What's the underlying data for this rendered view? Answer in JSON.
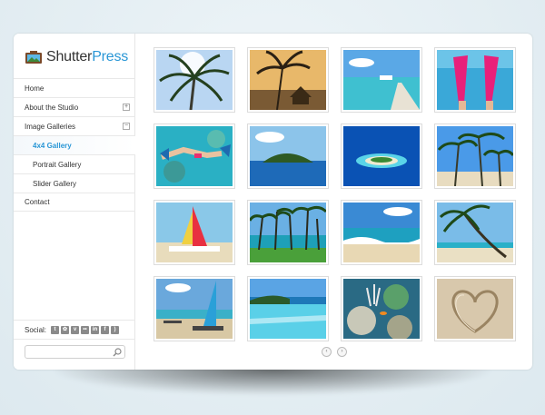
{
  "logo": {
    "word1": "Shutter",
    "word2": "Press"
  },
  "menu": [
    {
      "label": "Home",
      "sub": false,
      "active": false,
      "toggle": ""
    },
    {
      "label": "About the Studio",
      "sub": false,
      "active": false,
      "toggle": "+"
    },
    {
      "label": "Image Galleries",
      "sub": false,
      "active": false,
      "toggle": "−"
    },
    {
      "label": "4x4 Gallery",
      "sub": true,
      "active": true,
      "toggle": ""
    },
    {
      "label": "Portrait Gallery",
      "sub": true,
      "active": false,
      "toggle": ""
    },
    {
      "label": "Slider Gallery",
      "sub": true,
      "active": false,
      "toggle": ""
    },
    {
      "label": "Contact",
      "sub": false,
      "active": false,
      "toggle": ""
    }
  ],
  "social": {
    "label": "Social:",
    "icons": [
      "tumblr-icon",
      "dribbble-icon",
      "vimeo-icon",
      "flickr-icon",
      "linkedin-icon",
      "facebook-icon",
      "rss-icon"
    ]
  },
  "search": {
    "placeholder": ""
  },
  "gallery": {
    "thumbs": [
      "palm-sun-sky",
      "palm-sunset-hut",
      "pier-sea",
      "pink-flippers",
      "snorkeler-reef",
      "island-blue-sea",
      "atoll-aerial",
      "palms-beach",
      "sailboat-beach",
      "palm-lined-shore",
      "wave-beach",
      "leaning-palm",
      "catamaran-shore",
      "infinity-pool",
      "coral-reef",
      "heart-in-sand"
    ]
  },
  "pager": {
    "prev": "‹",
    "next": "›"
  },
  "colors": {
    "accent": "#2a97d6",
    "background": "#e4eef3"
  }
}
